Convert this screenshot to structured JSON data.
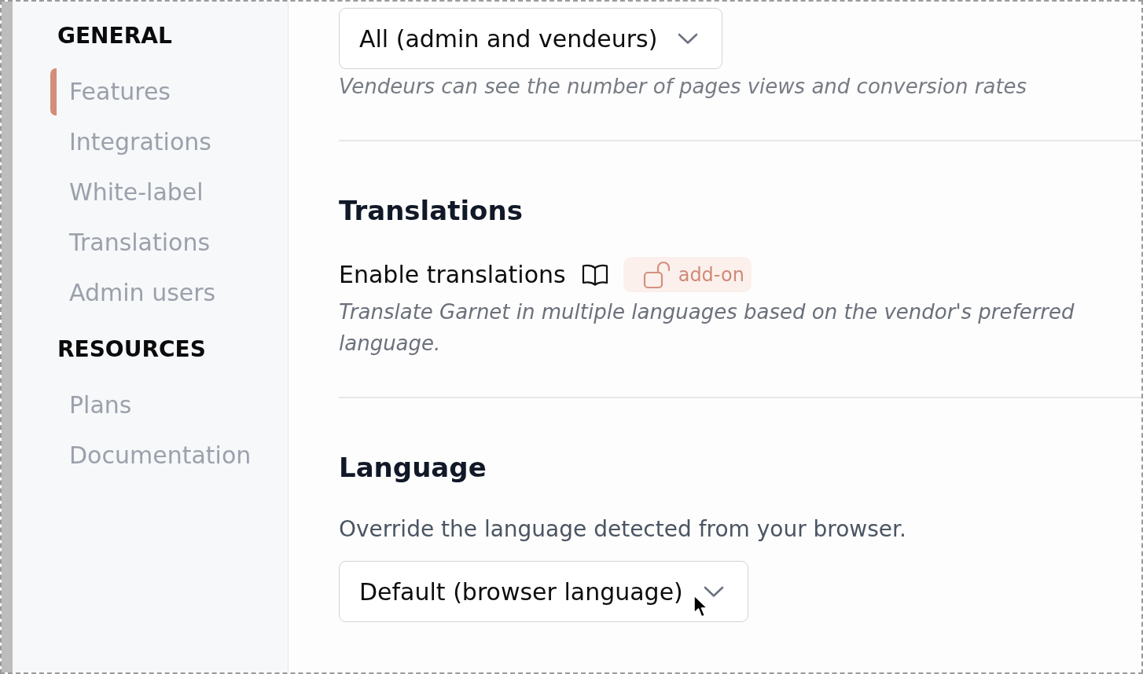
{
  "sidebar": {
    "sections": [
      {
        "heading": "GENERAL",
        "items": [
          {
            "label": "Features",
            "selected": true
          },
          {
            "label": "Integrations",
            "selected": false
          },
          {
            "label": "White-label",
            "selected": false
          },
          {
            "label": "Translations",
            "selected": false
          },
          {
            "label": "Admin users",
            "selected": false
          }
        ]
      },
      {
        "heading": "RESOURCES",
        "items": [
          {
            "label": "Plans",
            "selected": false
          },
          {
            "label": "Documentation",
            "selected": false
          }
        ]
      }
    ]
  },
  "content": {
    "sections": [
      {
        "fields": [
          {
            "kind": "select",
            "value": "All (admin and vendeurs)",
            "hint": "Vendeurs can see the number of pages views and conversion rates"
          }
        ]
      },
      {
        "title": "Translations",
        "fields": [
          {
            "kind": "feature",
            "label": "Enable translations",
            "badge": "add-on",
            "hint": "Translate Garnet in multiple languages based on the vendor's preferred language."
          }
        ]
      },
      {
        "title": "Language",
        "fields": [
          {
            "kind": "text",
            "text": "Override the language detected from your browser."
          },
          {
            "kind": "select",
            "value": "Default (browser language)"
          }
        ]
      }
    ]
  }
}
